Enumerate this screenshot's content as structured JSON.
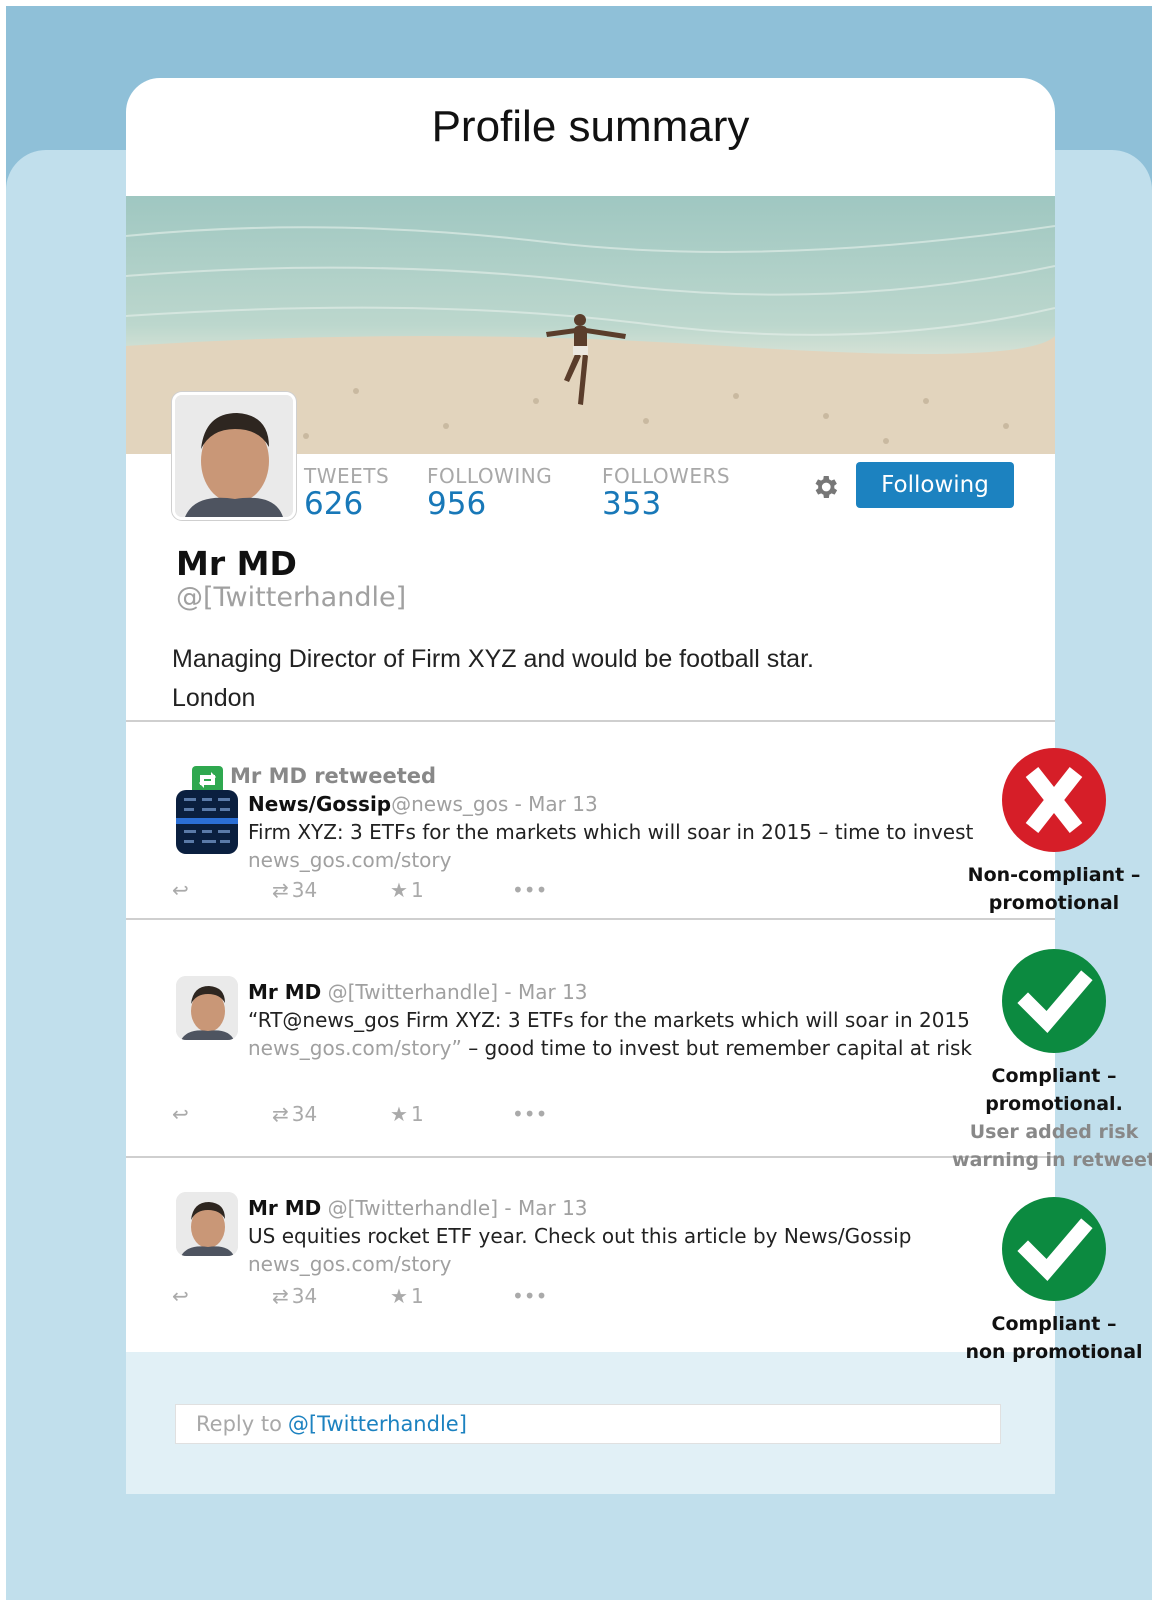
{
  "page": {
    "title": "Profile summary"
  },
  "profile": {
    "stats": [
      {
        "label": "TWEETS",
        "value": "626"
      },
      {
        "label": "FOLLOWING",
        "value": "956"
      },
      {
        "label": "FOLLOWERS",
        "value": "353"
      }
    ],
    "follow_button": "Following",
    "name": "Mr MD",
    "handle": "@[Twitterhandle]",
    "bio_line1": "Managing Director of Firm XYZ and would be football star.",
    "bio_line2": "London"
  },
  "tweets": [
    {
      "retweet_label": "Mr MD retweeted",
      "author": "News/Gossip",
      "meta": "@news_gos - Mar 13",
      "text": "Firm XYZ: 3 ETFs for the markets which will soar in 2015 – time to invest",
      "link": "news_gos.com/story",
      "retweets": "34",
      "likes": "1",
      "verdict": {
        "line1": "Non-compliant –",
        "line2": "promotional"
      }
    },
    {
      "author": "Mr MD",
      "meta": " @[Twitterhandle] - Mar 13",
      "text": "“RT@news_gos Firm XYZ: 3 ETFs for the markets which will soar in 2015",
      "link": "news_gos.com/story”",
      "text2": " – good time to invest but remember capital at risk",
      "retweets": "34",
      "likes": "1",
      "verdict": {
        "line1": "Compliant –",
        "line2": "promotional.",
        "line3": "User added risk",
        "line4": "warning in retweet"
      }
    },
    {
      "author": "Mr MD",
      "meta": " @[Twitterhandle] - Mar 13",
      "text": "US equities rocket ETF year. Check out this article by News/Gossip",
      "link": "news_gos.com/story",
      "retweets": "34",
      "likes": "1",
      "verdict": {
        "line1": "Compliant –",
        "line2": "non promotional"
      }
    }
  ],
  "reply": {
    "prefix": "Reply to",
    "handle": "@[Twitterhandle]"
  },
  "colors": {
    "accent": "#1c82c0",
    "noncompliant": "#d61e28",
    "compliant": "#0c8a40",
    "retweet": "#2fa84f"
  }
}
